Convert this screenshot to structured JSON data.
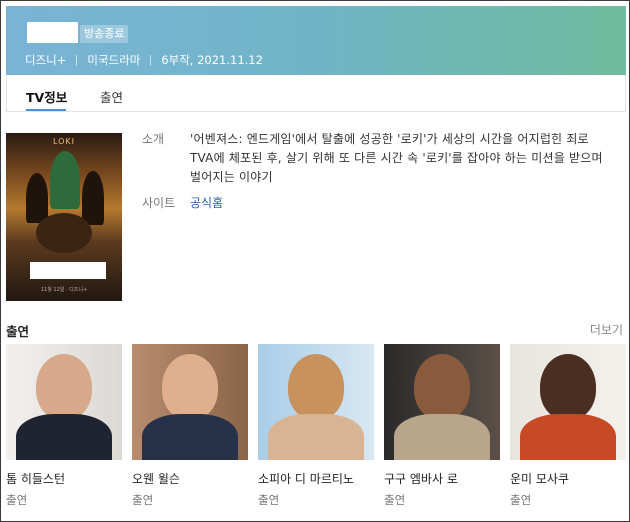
{
  "header": {
    "badge": "방송종료",
    "platform": "디즈니+",
    "genre": "미국드라마",
    "episodes_date": "6부작, 2021.11.12"
  },
  "tabs": [
    {
      "label": "TV정보",
      "active": true
    },
    {
      "label": "출연",
      "active": false
    }
  ],
  "poster": {
    "title_art": "LOKI",
    "caption": "11월 12일 · 디즈니+"
  },
  "info": {
    "intro_label": "소개",
    "intro_text": "'어벤져스: 엔드게임'에서 탈출에 성공한 '로키'가 세상의 시간을 어지럽힌 죄로 TVA에 체포된 후, 살기 위해 또 다른 시간 속 '로키'를 잡아야 하는 미션을 받으며 벌어지는 이야기",
    "site_label": "사이트",
    "site_link": "공식홈"
  },
  "cast": {
    "title": "출연",
    "more": "더보기",
    "members": [
      {
        "name": "톰 히들스턴",
        "role": "출연"
      },
      {
        "name": "오웬 윌슨",
        "role": "출연"
      },
      {
        "name": "소피아 디 마르티노",
        "role": "출연"
      },
      {
        "name": "구구 엠바사 로",
        "role": "출연"
      },
      {
        "name": "운미 모사쿠",
        "role": "출연"
      }
    ]
  },
  "colors": {
    "header_gradient_start": "#7ab3d6",
    "header_gradient_end": "#6fbc9e",
    "tab_underline": "#4a8fd8",
    "link": "#2b5fab"
  }
}
